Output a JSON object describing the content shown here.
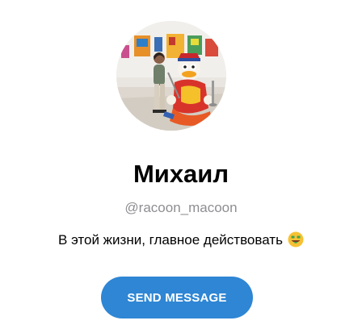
{
  "profile": {
    "name": "Михаил",
    "username": "@racoon_macoon",
    "bio": "В этой жизни, главное действовать",
    "bio_emoji_icon": "money-mouth-face-icon",
    "avatar_description_icon": "profile-photo"
  },
  "actions": {
    "send_label": "SEND MESSAGE"
  },
  "colors": {
    "accent": "#2e86d4",
    "username": "#8e8e93",
    "text": "#000000",
    "background": "#ffffff"
  }
}
